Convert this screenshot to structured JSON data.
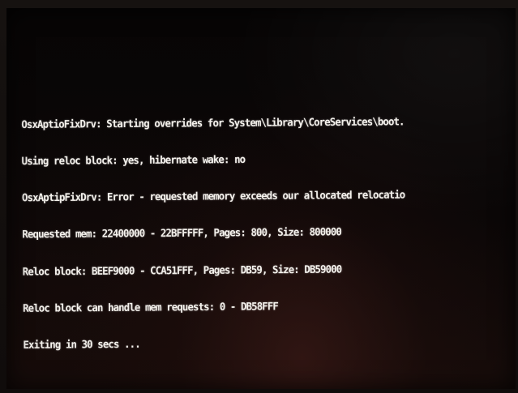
{
  "console": {
    "lines": [
      "OsxAptioFixDrv: Starting overrides for System\\Library\\CoreServices\\boot.",
      "Using reloc block: yes, hibernate wake: no",
      "OsxAptipFixDrv: Error - requested memory exceeds our allocated relocatio",
      "Requested mem: 22400000 - 22BFFFFF, Pages: 800, Size: 800000",
      "Reloc block: BEEF9000 - CCA51FFF, Pages: DB59, Size: DB59000",
      "Reloc block can handle mem requests: 0 - DB58FFF",
      "Exiting in 30 secs ..."
    ]
  },
  "colors": {
    "text": "#f4f1ec",
    "screen_background": "#070505",
    "bezel": "#161210"
  }
}
